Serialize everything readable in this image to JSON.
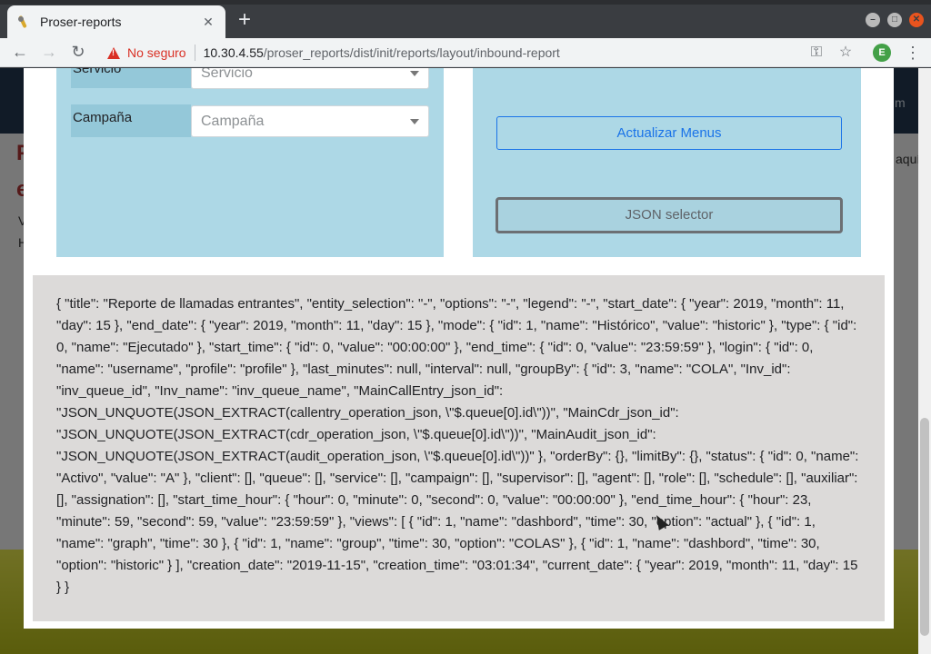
{
  "browser": {
    "tab": {
      "title": "Proser-reports",
      "close": "✕"
    },
    "new_tab": "+",
    "window_controls": {
      "minimize": "–",
      "maximize": "□",
      "close": "✕"
    },
    "nav": {
      "back": "←",
      "forward": "→",
      "reload": "↻"
    },
    "security_label": "No seguro",
    "url_host": "10.30.4.55",
    "url_path": "/proser_reports/dist/init/reports/layout/inbound-report",
    "profile_initial": "E",
    "menu": "⋮",
    "key_icon": "⚿",
    "star_icon": "☆"
  },
  "background": {
    "edge_fragments": {
      "r1": "P",
      "r2": "e",
      "r3": "V",
      "r4": "H",
      "aqui": "aquí",
      "m": "m"
    }
  },
  "modal": {
    "fields": [
      {
        "label": "Servicio",
        "placeholder": "Servicio"
      },
      {
        "label": "Campaña",
        "placeholder": "Campaña"
      }
    ],
    "update_menus_button": "Actualizar Menus",
    "json_selector_button": "JSON selector",
    "json_output": "{ \"title\": \"Reporte de llamadas entrantes\", \"entity_selection\": \"-\", \"options\": \"-\", \"legend\": \"-\", \"start_date\": { \"year\": 2019, \"month\": 11, \"day\": 15 }, \"end_date\": { \"year\": 2019, \"month\": 11, \"day\": 15 }, \"mode\": { \"id\": 1, \"name\": \"Histórico\", \"value\": \"historic\" }, \"type\": { \"id\": 0, \"name\": \"Ejecutado\" }, \"start_time\": { \"id\": 0, \"value\": \"00:00:00\" }, \"end_time\": { \"id\": 0, \"value\": \"23:59:59\" }, \"login\": { \"id\": 0, \"name\": \"username\", \"profile\": \"profile\" }, \"last_minutes\": null, \"interval\": null, \"groupBy\": { \"id\": 3, \"name\": \"COLA\", \"Inv_id\": \"inv_queue_id\", \"Inv_name\": \"inv_queue_name\", \"MainCallEntry_json_id\": \"JSON_UNQUOTE(JSON_EXTRACT(callentry_operation_json, \\\"$.queue[0].id\\\"))\", \"MainCdr_json_id\": \"JSON_UNQUOTE(JSON_EXTRACT(cdr_operation_json, \\\"$.queue[0].id\\\"))\", \"MainAudit_json_id\": \"JSON_UNQUOTE(JSON_EXTRACT(audit_operation_json, \\\"$.queue[0].id\\\"))\" }, \"orderBy\": {}, \"limitBy\": {}, \"status\": { \"id\": 0, \"name\": \"Activo\", \"value\": \"A\" }, \"client\": [], \"queue\": [], \"service\": [], \"campaign\": [], \"supervisor\": [], \"agent\": [], \"role\": [], \"schedule\": [], \"auxiliar\": [], \"assignation\": [], \"start_time_hour\": { \"hour\": 0, \"minute\": 0, \"second\": 0, \"value\": \"00:00:00\" }, \"end_time_hour\": { \"hour\": 23, \"minute\": 59, \"second\": 59, \"value\": \"23:59:59\" }, \"views\": [ { \"id\": 1, \"name\": \"dashbord\", \"time\": 30, \"option\": \"actual\" }, { \"id\": 1, \"name\": \"graph\", \"time\": 30 }, { \"id\": 1, \"name\": \"group\", \"time\": 30, \"option\": \"COLAS\" }, { \"id\": 1, \"name\": \"dashbord\", \"time\": 30, \"option\": \"historic\" } ], \"creation_date\": \"2019-11-15\", \"creation_time\": \"03:01:34\", \"current_date\": { \"year\": 2019, \"month\": 11, \"day\": 15 } }"
  }
}
